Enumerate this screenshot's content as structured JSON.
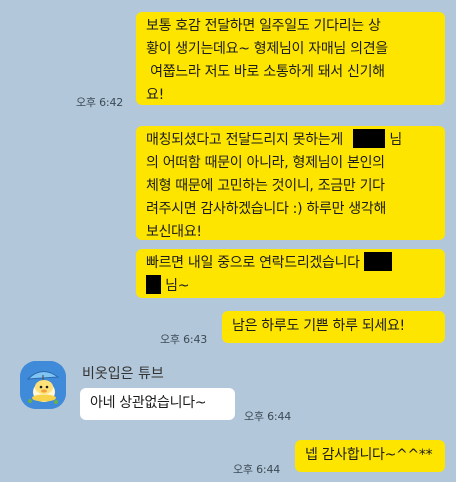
{
  "messages": [
    {
      "id": "m1",
      "side": "me",
      "time": "오후 6:42",
      "lines": [
        "보통 호감 전달하면 일주일도 기다리는 상",
        "황이 생기는데요~ 형제님이 자매님 의견을",
        " 여쭙느라 저도 바로 소통하게 돼서 신기해",
        "요!"
      ]
    },
    {
      "id": "m2",
      "side": "me",
      "lines": [
        "매칭되셨다고 전달드리지 못하는게",
        "님",
        "의 어떠함 때문이 아니라, 형제님이 본인의",
        "체형 때문에 고민하는 것이니, 조금만 기다",
        "려주시면 감사하겠습니다 :) 하루만 생각해",
        "보신대요!"
      ]
    },
    {
      "id": "m3",
      "side": "me",
      "lines": [
        "빠르면 내일 중으로 연락드리겠습니다",
        "님~"
      ]
    },
    {
      "id": "m4",
      "side": "me",
      "time": "오후 6:43",
      "text": "남은 하루도 기쁜 하루 되세요!"
    },
    {
      "id": "m5",
      "side": "other",
      "sender": "비옷입은 튜브",
      "time": "오후 6:44",
      "text": "아네 상관없습니다~"
    },
    {
      "id": "m6",
      "side": "me",
      "time": "오후 6:44",
      "text": "넵 감사합니다~^^**"
    }
  ],
  "colors": {
    "background": "#b2c7d9",
    "my_bubble": "#fee500",
    "other_bubble": "#ffffff"
  }
}
